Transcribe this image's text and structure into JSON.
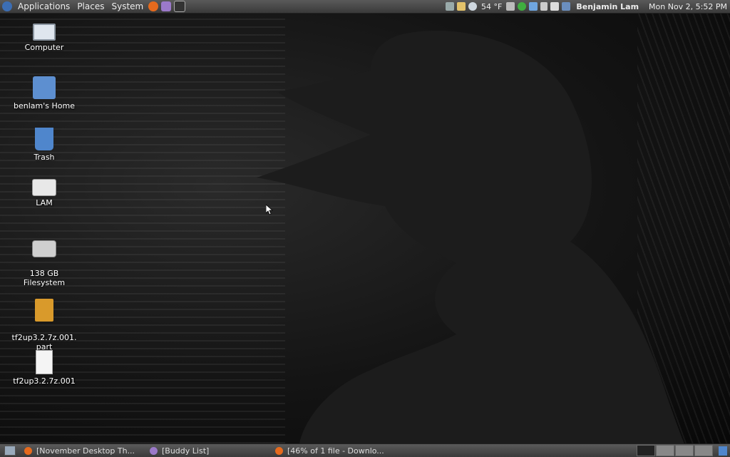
{
  "top_panel": {
    "menus": [
      "Applications",
      "Places",
      "System"
    ],
    "weather": "54 °F",
    "user_name": "Benjamin Lam",
    "clock": "Mon Nov  2,  5:52 PM"
  },
  "desktop": {
    "icons": [
      {
        "label": "Computer",
        "icon": "computer-icon"
      },
      {
        "label": "benlam's Home",
        "icon": "home-folder-icon"
      },
      {
        "label": "Trash",
        "icon": "trash-icon"
      },
      {
        "label": "LAM",
        "icon": "usb-drive-icon"
      },
      {
        "label": "138 GB\nFilesystem",
        "icon": "hard-drive-icon"
      },
      {
        "label": "tf2up3.2.7z.001.\npart",
        "icon": "package-icon"
      },
      {
        "label": "tf2up3.2.7z.001",
        "icon": "document-icon"
      }
    ]
  },
  "taskbar": {
    "tasks": [
      {
        "label": "[November Desktop Th...",
        "icon": "firefox-icon"
      },
      {
        "label": "[Buddy List]",
        "icon": "pidgin-icon"
      },
      {
        "label": "[46% of 1 file - Downlo...",
        "icon": "download-icon"
      }
    ]
  },
  "colors": {
    "panel": "#4a4a4a",
    "desktop_bg": "#0b0b0b",
    "accent": "#5d8fd0"
  }
}
